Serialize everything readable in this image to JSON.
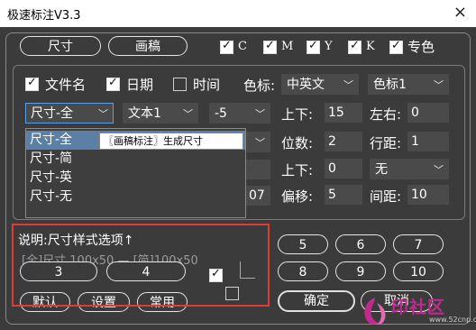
{
  "window": {
    "title": "极速标注V3.3",
    "close_glyph": "×"
  },
  "top_buttons": {
    "size_label": "尺寸",
    "draft_label": "画稿"
  },
  "color_checks": [
    {
      "label": "C",
      "checked": true
    },
    {
      "label": "M",
      "checked": true
    },
    {
      "label": "Y",
      "checked": true
    },
    {
      "label": "K",
      "checked": true
    },
    {
      "label": "专色",
      "checked": true
    }
  ],
  "row1": {
    "filename_label": "文件名",
    "date_label": "日期",
    "time_label": "时间",
    "color_label_caption": "色标:",
    "lang_select": "中英文",
    "color_mark_select": "色标1"
  },
  "row2": {
    "size_style_select": "尺寸-全",
    "text_select": "文本1",
    "offset_select": "-5",
    "updown_label": "上下:",
    "updown_value": "15",
    "leftright_label": "左右:",
    "leftright_value": "0"
  },
  "row3": {
    "digits_label": "位数:",
    "digits_value": "2",
    "linespacing_label": "行距:",
    "linespacing_value": "1"
  },
  "row4": {
    "updown_label": "上下:",
    "updown_value": "0",
    "none_select": "无"
  },
  "row5": {
    "partial_value": "07",
    "offset_label": "偏移:",
    "offset_value": "5",
    "spacing_label": "间距:",
    "spacing_value": "10"
  },
  "dropdown_options": [
    "尺寸-全",
    "尺寸-简",
    "尺寸-英",
    "尺寸-无"
  ],
  "tooltip": "〖画稿标注〗生成尺寸",
  "explain": {
    "text": "说明:尺寸样式选项↑",
    "obscured_line": "[全]尺寸 100x50 — [简]100x50"
  },
  "presets": [
    "3",
    "4",
    "5",
    "6",
    "7",
    "8",
    "9",
    "10"
  ],
  "bottom_buttons": {
    "default_label": "默认",
    "settings_label": "设置",
    "common_label": "常用",
    "ok_label": "确定",
    "cancel_label": "取消"
  },
  "watermark": {
    "text": "印社区",
    "url": "www.52cnp.com"
  },
  "colors": {
    "background": "#3b3b3b",
    "highlight_red": "#e03a3a",
    "selection": "#5c7fa6",
    "watermark": "#c02a8e"
  }
}
